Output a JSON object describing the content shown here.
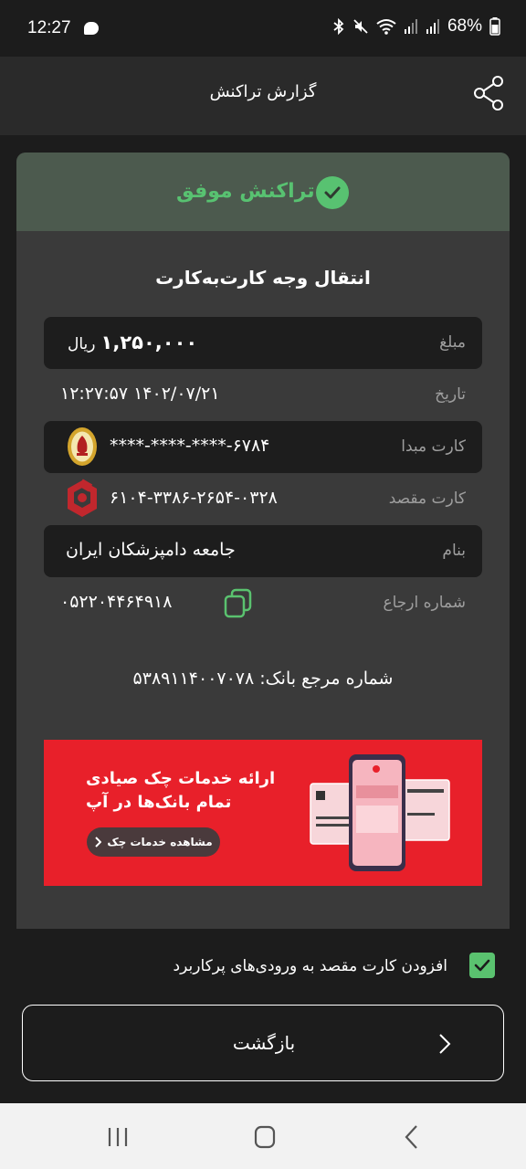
{
  "status_bar": {
    "time": "12:27",
    "battery": "68%",
    "icons": [
      "chat-icon",
      "bluetooth-icon",
      "mute-icon",
      "wifi-icon",
      "signal-icon",
      "signal-icon-2",
      "battery-icon"
    ]
  },
  "header": {
    "title": "گزارش تراکنش",
    "share_icon": "share-icon"
  },
  "receipt": {
    "status_text": "تراکنش موفق",
    "status_color": "#58c271",
    "transaction_type": "انتقال وجه کارت‌به‌کارت",
    "amount": {
      "label": "مبلغ",
      "value": "۱,۲۵۰,۰۰۰",
      "unit": "ریال"
    },
    "date": {
      "label": "تاریخ",
      "value": "۱۴۰۲/۰۷/۲۱ ۱۲:۲۷:۵۷"
    },
    "source_card": {
      "label": "کارت مبدا",
      "value": "****-****-****-۶۷۸۴",
      "bank_logo": "bank-melli-logo"
    },
    "dest_card": {
      "label": "کارت مقصد",
      "value": "۶۱۰۴-۳۳۸۶-۲۶۵۴-۰۳۲۸",
      "bank_logo": "bank-mellat-logo"
    },
    "name": {
      "label": "بنام",
      "value": "جامعه دامپزشکان ایران"
    },
    "reference": {
      "label": "شماره ارجاع",
      "value": "۰۵۲۲۰۴۴۶۴۹۱۸",
      "copy_icon": "copy-icon"
    },
    "bank_reference": "شماره مرجع بانک: ۵۳۸۹۱۱۴۰۰۷۰۷۸"
  },
  "banner": {
    "line1": "ارائه خدمات چک صیادی",
    "line2": "تمام بانک‌ها در آپ",
    "button": "مشاهده خدمات چک",
    "accent": "#e8202a"
  },
  "favorites": {
    "label": "افزودن کارت مقصد به ورودی‌های پرکاربرد",
    "checked": true
  },
  "back_button": {
    "label": "بازگشت"
  },
  "nav": [
    "recent-apps-icon",
    "home-icon",
    "back-nav-icon"
  ]
}
